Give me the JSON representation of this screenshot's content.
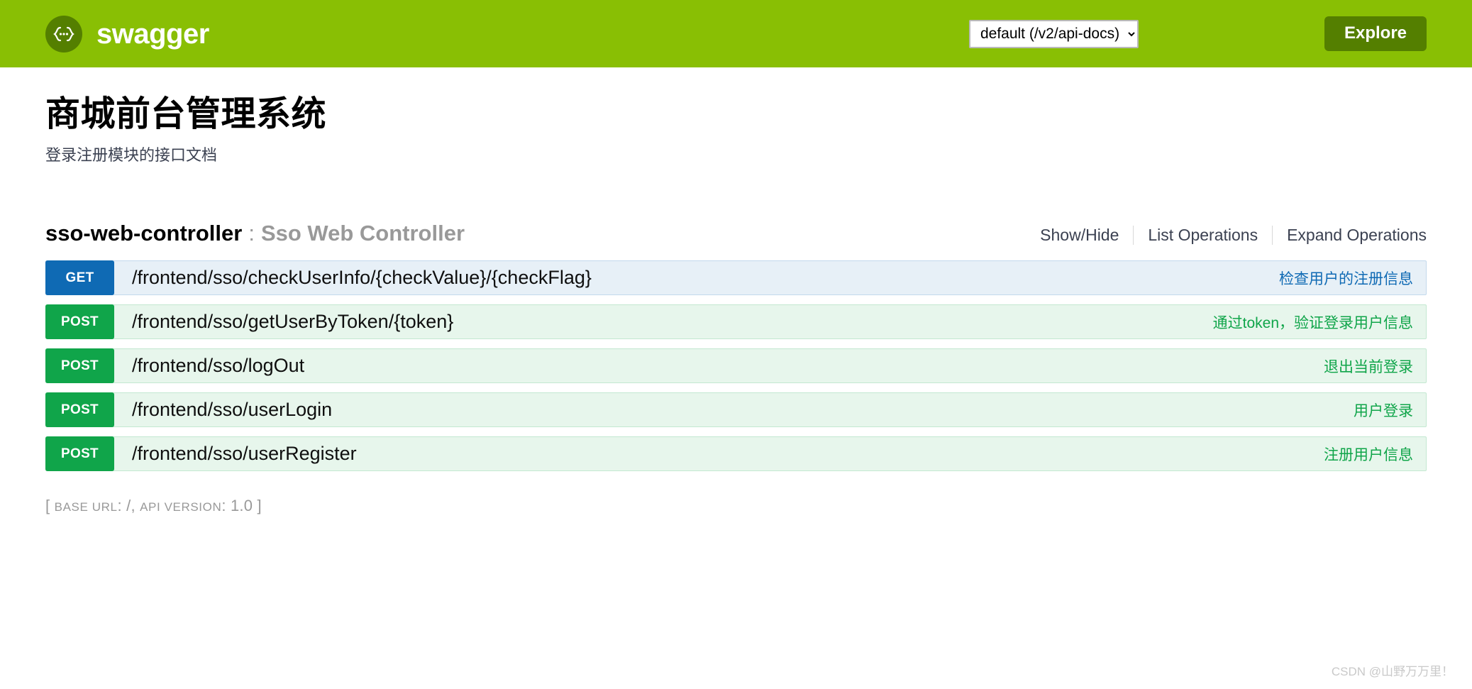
{
  "header": {
    "brand_name": "swagger",
    "logo_icon": "swagger-braces-icon",
    "api_select": {
      "selected": "default (/v2/api-docs)",
      "options": [
        "default (/v2/api-docs)"
      ]
    },
    "explore_label": "Explore",
    "background_color": "#89bf04",
    "explore_color": "#547f00"
  },
  "info": {
    "title": "商城前台管理系统",
    "subtitle": "登录注册模块的接口文档"
  },
  "resource": {
    "name": "sso-web-controller",
    "separator": ":",
    "description": "Sso Web Controller",
    "options": {
      "show_hide": "Show/Hide",
      "list_operations": "List Operations",
      "expand_operations": "Expand Operations"
    }
  },
  "operations": [
    {
      "method": "GET",
      "path": "/frontend/sso/checkUserInfo/{checkValue}/{checkFlag}",
      "summary": "检查用户的注册信息",
      "color": "#0f6ab4"
    },
    {
      "method": "POST",
      "path": "/frontend/sso/getUserByToken/{token}",
      "summary": "通过token，验证登录用户信息",
      "color": "#10a54a"
    },
    {
      "method": "POST",
      "path": "/frontend/sso/logOut",
      "summary": "退出当前登录",
      "color": "#10a54a"
    },
    {
      "method": "POST",
      "path": "/frontend/sso/userLogin",
      "summary": "用户登录",
      "color": "#10a54a"
    },
    {
      "method": "POST",
      "path": "/frontend/sso/userRegister",
      "summary": "注册用户信息",
      "color": "#10a54a"
    }
  ],
  "footer": {
    "open_bracket": "[",
    "base_url_label": "BASE URL",
    "base_url_value": "/",
    "comma": ",",
    "version_label": "API VERSION",
    "version_value": "1.0",
    "close_bracket": "]"
  },
  "watermark": "CSDN @山野万万里！"
}
